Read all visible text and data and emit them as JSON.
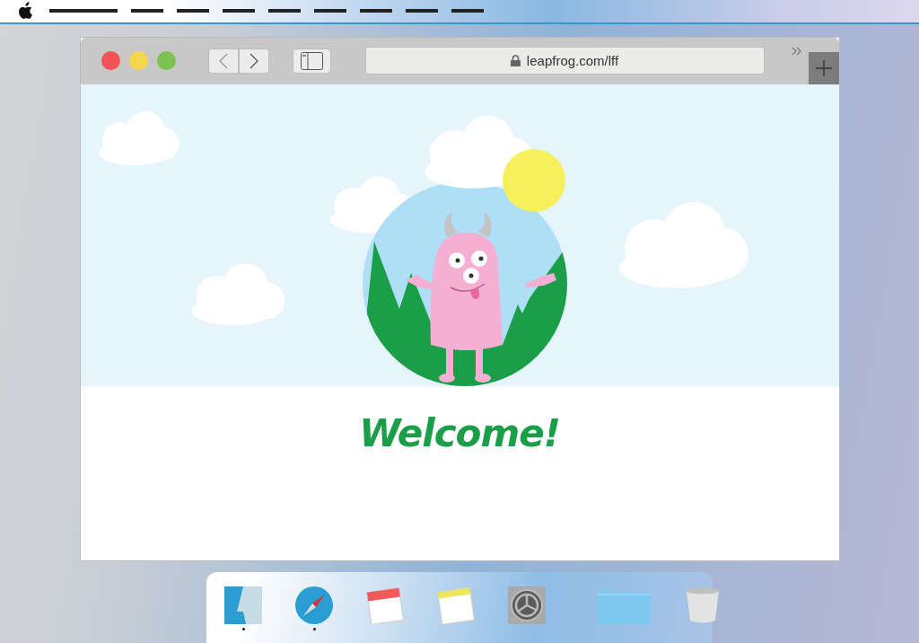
{
  "browser": {
    "url": "leapfrog.com/lff"
  },
  "page": {
    "heading": "Welcome!"
  },
  "dock": {
    "apps": [
      {
        "kind": "finder",
        "running": true
      },
      {
        "kind": "compass",
        "running": true
      },
      {
        "kind": "calendar",
        "running": false
      },
      {
        "kind": "notes",
        "running": false
      },
      {
        "kind": "settings",
        "running": false
      }
    ],
    "others": [
      {
        "kind": "folder",
        "running": false
      },
      {
        "kind": "trash",
        "running": false
      }
    ]
  }
}
